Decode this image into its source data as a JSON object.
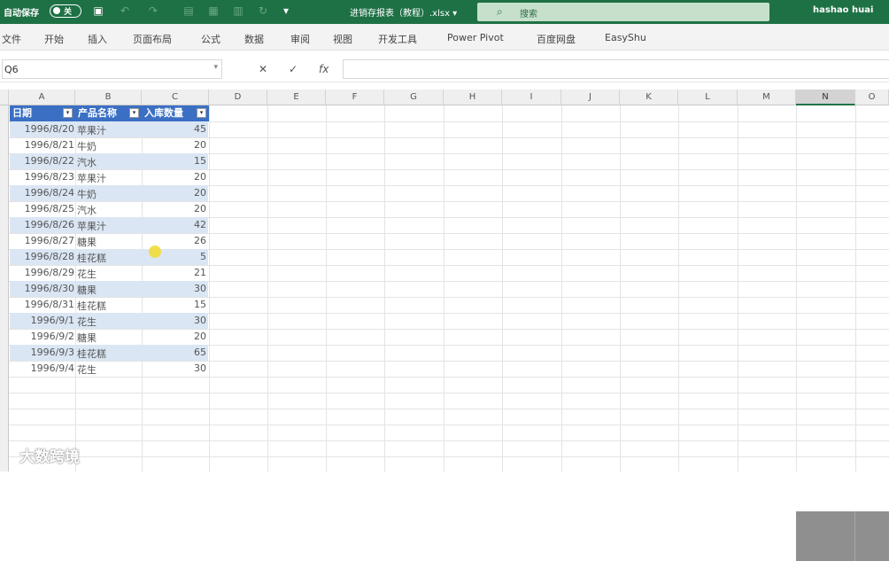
{
  "titlebar": {
    "autosave_label": "自动保存",
    "toggle_state": "关",
    "filename": "进销存报表（教程）.xlsx ▾",
    "search_placeholder": "搜索",
    "user": "hashao huai",
    "accent_color": "#1e7145"
  },
  "ribbon": {
    "tabs": [
      "文件",
      "开始",
      "插入",
      "页面布局",
      "公式",
      "数据",
      "审阅",
      "视图",
      "开发工具",
      "Power Pivot",
      "百度网盘",
      "EasyShu"
    ]
  },
  "formula_bar": {
    "name_box": "Q6",
    "cancel_icon": "✕",
    "enter_icon": "✓",
    "fx_icon": "fx",
    "formula": ""
  },
  "columns": [
    "A",
    "B",
    "C",
    "D",
    "E",
    "F",
    "G",
    "H",
    "I",
    "J",
    "K",
    "L",
    "M",
    "N",
    "O"
  ],
  "selected_column": "N",
  "table": {
    "headers": [
      "日期",
      "产品名称",
      "入库数量"
    ],
    "rows": [
      {
        "date": "1996/8/20",
        "product": "苹果汁",
        "qty": "45"
      },
      {
        "date": "1996/8/21",
        "product": "牛奶",
        "qty": "20"
      },
      {
        "date": "1996/8/22",
        "product": "汽水",
        "qty": "15"
      },
      {
        "date": "1996/8/23",
        "product": "苹果汁",
        "qty": "20"
      },
      {
        "date": "1996/8/24",
        "product": "牛奶",
        "qty": "20"
      },
      {
        "date": "1996/8/25",
        "product": "汽水",
        "qty": "20"
      },
      {
        "date": "1996/8/26",
        "product": "苹果汁",
        "qty": "42"
      },
      {
        "date": "1996/8/27",
        "product": "糖果",
        "qty": "26"
      },
      {
        "date": "1996/8/28",
        "product": "桂花糕",
        "qty": "5"
      },
      {
        "date": "1996/8/29",
        "product": "花生",
        "qty": "21"
      },
      {
        "date": "1996/8/30",
        "product": "糖果",
        "qty": "30"
      },
      {
        "date": "1996/8/31",
        "product": "桂花糕",
        "qty": "15"
      },
      {
        "date": "1996/9/1",
        "product": "花生",
        "qty": "30"
      },
      {
        "date": "1996/9/2",
        "product": "糖果",
        "qty": "20"
      },
      {
        "date": "1996/9/3",
        "product": "桂花糕",
        "qty": "65"
      },
      {
        "date": "1996/9/4",
        "product": "花生",
        "qty": "30"
      }
    ]
  },
  "watermark": "大数跨境",
  "table_header_color": "#3a6fc4",
  "table_band_color": "#dbe6f4"
}
